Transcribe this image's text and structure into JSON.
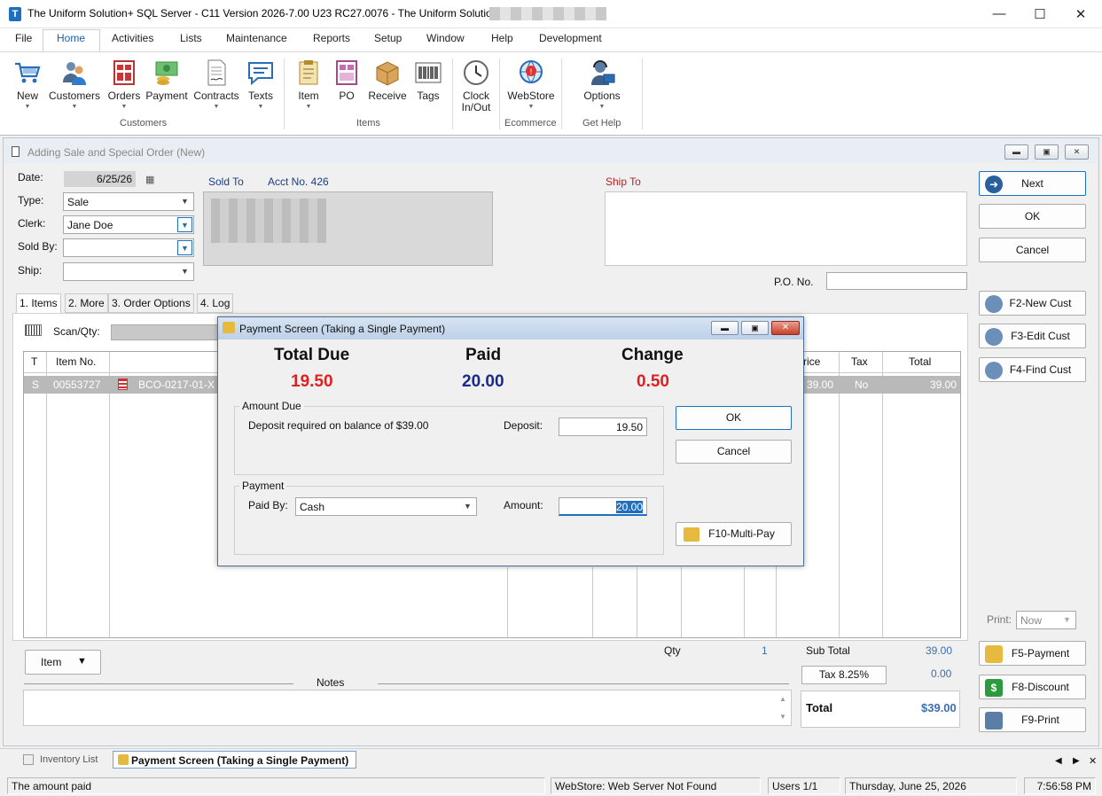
{
  "window": {
    "title": "The Uniform Solution+ SQL Server - C11 Version 2026-7.00 U23 RC27.0076 - The Uniform Solution",
    "minimize_glyph": "—",
    "maximize_glyph": "☐",
    "close_glyph": "✕"
  },
  "menu": [
    "File",
    "Home",
    "Activities",
    "Lists",
    "Maintenance",
    "Reports",
    "Setup",
    "Window",
    "Help",
    "Development"
  ],
  "ribbon": {
    "buttons": [
      {
        "label": "New",
        "icon": "cart-icon"
      },
      {
        "label": "Customers",
        "icon": "customers-icon"
      },
      {
        "label": "Orders",
        "icon": "orders-icon"
      },
      {
        "label": "Payment",
        "icon": "payment-icon"
      },
      {
        "label": "Contracts",
        "icon": "contracts-icon"
      },
      {
        "label": "Texts",
        "icon": "texts-icon"
      },
      {
        "label": "Item",
        "icon": "item-icon"
      },
      {
        "label": "PO",
        "icon": "po-icon"
      },
      {
        "label": "Receive",
        "icon": "receive-icon"
      },
      {
        "label": "Tags",
        "icon": "barcode-icon"
      },
      {
        "label": "Clock\nIn/Out",
        "icon": "clock-icon"
      },
      {
        "label": "WebStore",
        "icon": "webstore-icon"
      },
      {
        "label": "Options",
        "icon": "support-icon"
      }
    ],
    "groups": [
      "Customers",
      "Items",
      "Ecommerce",
      "Get Help"
    ]
  },
  "sale_window": {
    "title": "Adding Sale and Special Order  (New)",
    "date_label": "Date:",
    "date_value": "6/25/26",
    "type_label": "Type:",
    "type_value": "Sale",
    "clerk_label": "Clerk:",
    "clerk_value": "Jane Doe",
    "soldby_label": "Sold By:",
    "soldby_value": "",
    "ship_label": "Ship:",
    "ship_value": "",
    "sold_to_label": "Sold To",
    "acct_label": "Acct No. 426",
    "ship_to_label": "Ship To",
    "po_label": "P.O. No.",
    "po_value": "",
    "tabs": [
      "1. Items",
      "2. More",
      "3. Order Options",
      "4. Log"
    ],
    "scan_label": "Scan/Qty:",
    "grid_headers": {
      "t": "T",
      "item_no": "Item No.",
      "price": "rice",
      "tax": "Tax",
      "total": "Total"
    },
    "grid_row": {
      "t": "S",
      "item_no": "00553727",
      "desc": "BCO-0217-01-X",
      "price": "39.00",
      "tax": "No",
      "total": "39.00"
    },
    "item_button": "Item",
    "notes_label": "Notes",
    "qty_label": "Qty",
    "qty_value": "1",
    "subtotal_label": "Sub Total",
    "subtotal_value": "39.00",
    "tax_button": "Tax  8.25%",
    "tax_value": "0.00",
    "total_label": "Total",
    "total_value": "$39.00",
    "print_label": "Print:",
    "print_value": "Now"
  },
  "side_buttons": {
    "next": "Next",
    "ok": "OK",
    "cancel": "Cancel",
    "new_cust": "F2-New Cust",
    "edit_cust": "F3-Edit Cust",
    "find_cust": "F4-Find Cust",
    "payment": "F5-Payment",
    "discount": "F8-Discount",
    "print": "F9-Print"
  },
  "payment_dialog": {
    "title": "Payment Screen  (Taking a Single Payment)",
    "total_due_label": "Total Due",
    "total_due_value": "19.50",
    "paid_label": "Paid",
    "paid_value": "20.00",
    "change_label": "Change",
    "change_value": "0.50",
    "amount_due_group": "Amount Due",
    "deposit_text": "Deposit required on balance of $39.00",
    "deposit_label": "Deposit:",
    "deposit_value": "19.50",
    "payment_group": "Payment",
    "paid_by_label": "Paid By:",
    "paid_by_value": "Cash",
    "amount_label": "Amount:",
    "amount_value": "20.00",
    "ok": "OK",
    "cancel": "Cancel",
    "multipay": "F10-Multi-Pay",
    "colors": {
      "total_due": "#e02020",
      "paid": "#1a2a8a",
      "change": "#e02020"
    }
  },
  "taskbar": {
    "tabs": [
      "Inventory List",
      "Payment Screen  (Taking a Single Payment)"
    ]
  },
  "status": {
    "message": "The amount paid",
    "webstore": "WebStore: Web Server Not Found",
    "users": "Users 1/1",
    "date": "Thursday, June 25, 2026",
    "time": "7:56:58 PM"
  }
}
